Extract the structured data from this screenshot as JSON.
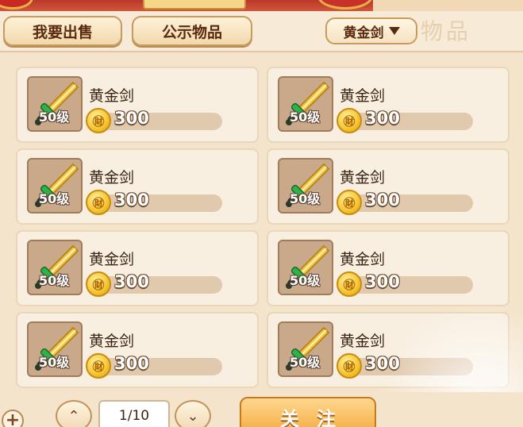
{
  "header": {
    "tabs": [
      {
        "label": "我要出售"
      },
      {
        "label": "公示物品"
      }
    ],
    "filter": {
      "selected": "黄金剑"
    },
    "bg_text": "物品"
  },
  "items": [
    {
      "name": "黄金剑",
      "level": "50级",
      "price": "300"
    },
    {
      "name": "黄金剑",
      "level": "50级",
      "price": "300"
    },
    {
      "name": "黄金剑",
      "level": "50级",
      "price": "300"
    },
    {
      "name": "黄金剑",
      "level": "50级",
      "price": "300"
    },
    {
      "name": "黄金剑",
      "level": "50级",
      "price": "300"
    },
    {
      "name": "黄金剑",
      "level": "50级",
      "price": "300"
    },
    {
      "name": "黄金剑",
      "level": "50级",
      "price": "300"
    },
    {
      "name": "黄金剑",
      "level": "50级",
      "price": "300"
    }
  ],
  "coin_glyph": "㊖",
  "footer": {
    "plus": "+",
    "up_arrow": "⌃",
    "down_arrow": "⌄",
    "page": "1/10",
    "follow_label": "关注"
  },
  "colors": {
    "background": "#f4e4cc",
    "card": "#f8efe1",
    "button_orange": "#f2a93b",
    "text_brown": "#5a2a10"
  }
}
